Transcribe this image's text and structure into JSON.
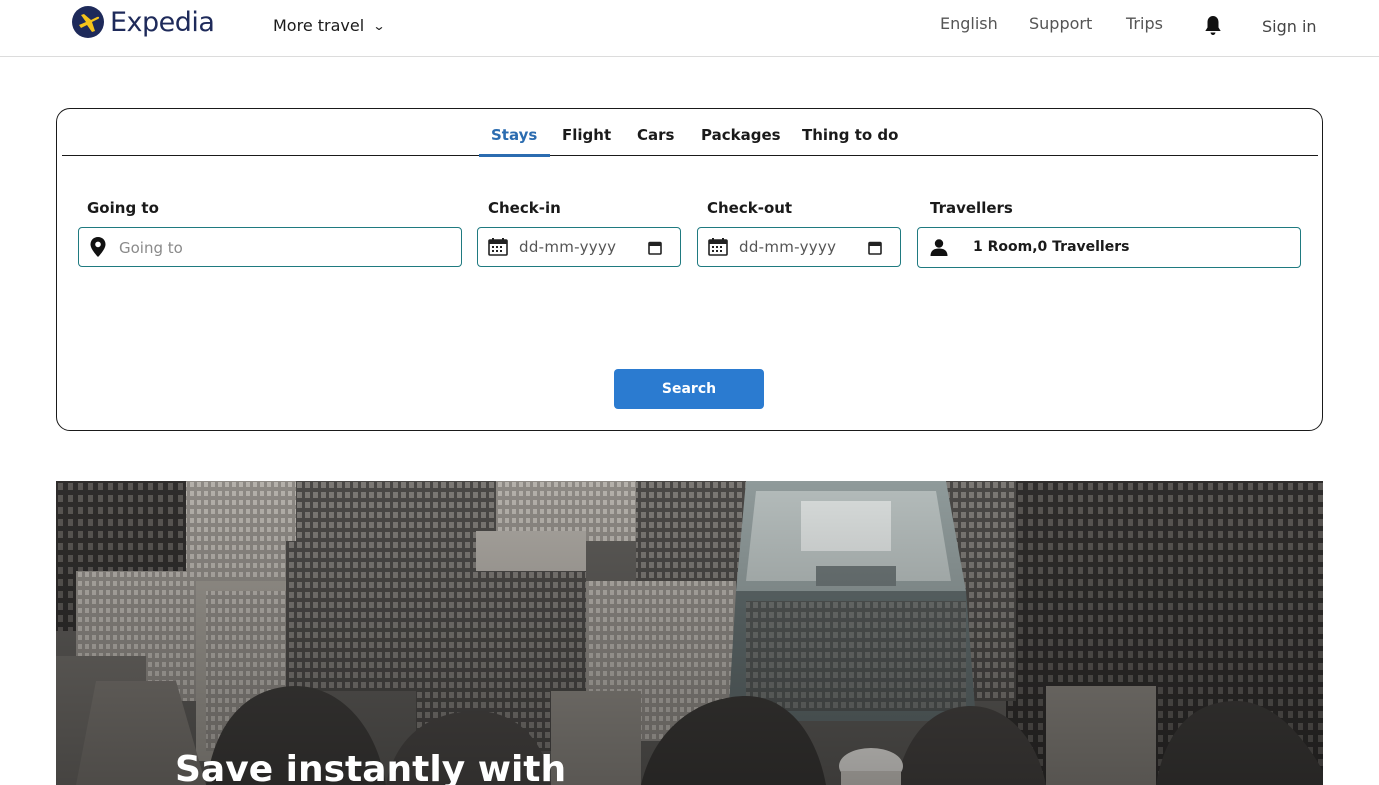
{
  "header": {
    "brand": "Expedia",
    "more_travel": "More travel",
    "nav": {
      "english": "English",
      "support": "Support",
      "trips": "Trips"
    },
    "sign_in": "Sign in"
  },
  "search": {
    "tabs": [
      {
        "label": "Stays",
        "active": true
      },
      {
        "label": "Flight",
        "active": false
      },
      {
        "label": "Cars",
        "active": false
      },
      {
        "label": "Packages",
        "active": false
      },
      {
        "label": "Thing to do",
        "active": false
      }
    ],
    "going_to": {
      "label": "Going to",
      "placeholder": "Going to"
    },
    "check_in": {
      "label": "Check-in",
      "value": "dd-mm-yyyy"
    },
    "check_out": {
      "label": "Check-out",
      "value": "dd-mm-yyyy"
    },
    "travellers": {
      "label": "Travellers",
      "value": "1 Room,0 Travellers"
    },
    "button": "Search"
  },
  "hero": {
    "title": "Save instantly with"
  },
  "colors": {
    "brand_navy": "#1e2a5a",
    "accent_blue": "#2b6cb0",
    "button_blue": "#2b7bd0",
    "field_border": "#1f7a80"
  },
  "icons": [
    "expedia-logo-icon",
    "chevron-down-icon",
    "bell-icon",
    "location-pin-icon",
    "calendar-icon",
    "user-icon"
  ]
}
